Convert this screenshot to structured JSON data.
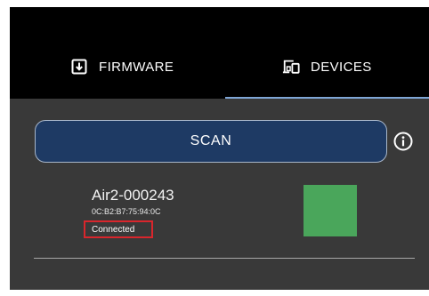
{
  "tabs": [
    {
      "label": "FIRMWARE",
      "icon": "download-icon",
      "selected": false
    },
    {
      "label": "DEVICES",
      "icon": "devices-icon",
      "selected": true
    }
  ],
  "scan_button": {
    "label": "SCAN"
  },
  "info_icon": "info-icon",
  "device": {
    "name": "Air2-000243",
    "mac": "0C:B2:B7:75:94:0C",
    "status": "Connected",
    "status_color": "#d9262c",
    "swatch_color": "#4aa65b"
  },
  "colors": {
    "tab_bar": "#000000",
    "background": "#393939",
    "tab_indicator": "#7fa6d6",
    "scan_button": "#1e3a64"
  }
}
